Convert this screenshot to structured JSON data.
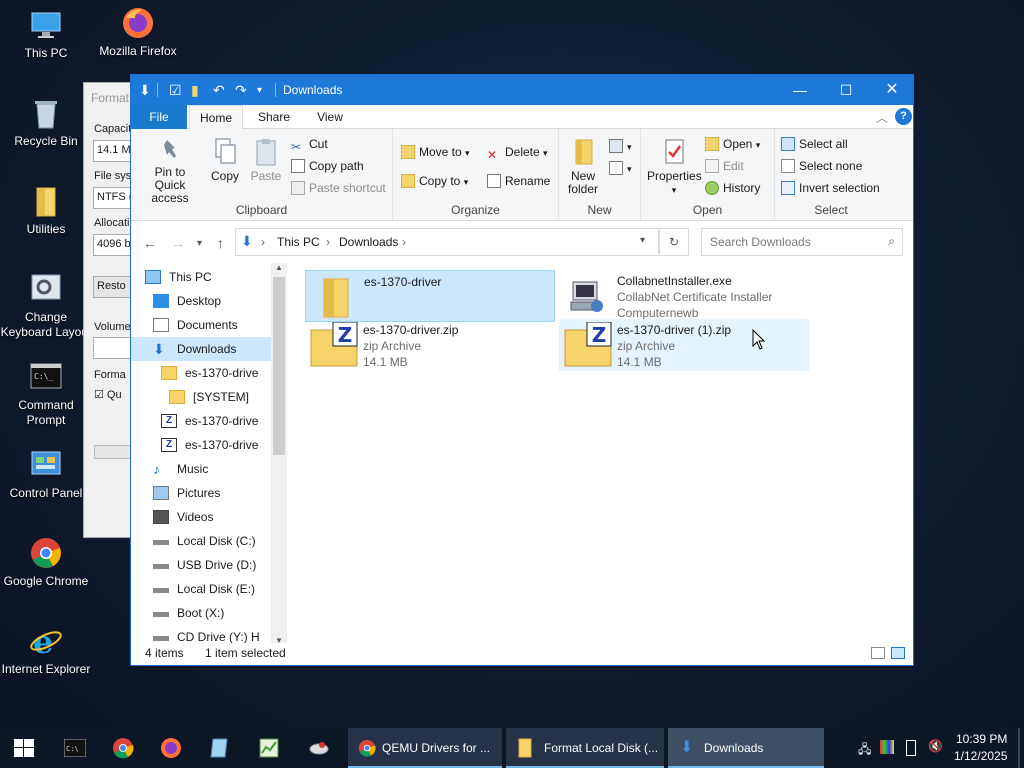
{
  "desktop": {
    "icons": [
      {
        "label": "This PC"
      },
      {
        "label": "Mozilla Firefox"
      },
      {
        "label": "Recycle Bin"
      },
      {
        "label": "Utilities"
      },
      {
        "label": "Change Keyboard Layout"
      },
      {
        "label": "Command Prompt"
      },
      {
        "label": "Control Panel"
      },
      {
        "label": "Google Chrome"
      },
      {
        "label": "Internet Explorer"
      }
    ]
  },
  "format_dialog": {
    "title": "Format",
    "capacity_label": "Capacity",
    "capacity_value": "14.1 M",
    "filesystem_label": "File sys",
    "filesystem_value": "NTFS (",
    "allocation_label": "Allocatio",
    "allocation_value": "4096 b",
    "restore_button": "Resto",
    "volume_label": "Volume",
    "format_options_label": "Forma",
    "quick_label": "Qu"
  },
  "explorer": {
    "title": "Downloads",
    "tabs": [
      "File",
      "Home",
      "Share",
      "View"
    ],
    "ribbon": {
      "clipboard": {
        "name": "Clipboard",
        "pin": "Pin to Quick access",
        "copy": "Copy",
        "paste": "Paste",
        "cut": "Cut",
        "copy_path": "Copy path",
        "paste_shortcut": "Paste shortcut"
      },
      "organize": {
        "name": "Organize",
        "move_to": "Move to",
        "copy_to": "Copy to",
        "delete": "Delete",
        "rename": "Rename"
      },
      "new": {
        "name": "New",
        "new_folder": "New folder"
      },
      "open": {
        "name": "Open",
        "properties": "Properties",
        "open": "Open",
        "edit": "Edit",
        "history": "History"
      },
      "select": {
        "name": "Select",
        "select_all": "Select all",
        "select_none": "Select none",
        "invert": "Invert selection"
      }
    },
    "address": {
      "segments": [
        "This PC",
        "Downloads"
      ],
      "search_placeholder": "Search Downloads"
    },
    "nav": [
      {
        "label": "This PC"
      },
      {
        "label": "Desktop"
      },
      {
        "label": "Documents"
      },
      {
        "label": "Downloads"
      },
      {
        "label": "es-1370-drive"
      },
      {
        "label": "[SYSTEM]"
      },
      {
        "label": "es-1370-drive"
      },
      {
        "label": "es-1370-drive"
      },
      {
        "label": "Music"
      },
      {
        "label": "Pictures"
      },
      {
        "label": "Videos"
      },
      {
        "label": "Local Disk (C:)"
      },
      {
        "label": "USB Drive (D:)"
      },
      {
        "label": "Local Disk (E:)"
      },
      {
        "label": "Boot (X:)"
      },
      {
        "label": "CD Drive (Y:) H"
      }
    ],
    "files": [
      {
        "name": "es-1370-driver",
        "type": "",
        "size": ""
      },
      {
        "name": "CollabnetInstaller.exe",
        "type": "CollabNet Certificate Installer",
        "size": "Computernewb"
      },
      {
        "name": "es-1370-driver.zip",
        "type": "zip Archive",
        "size": "14.1 MB"
      },
      {
        "name": "es-1370-driver (1).zip",
        "type": "zip Archive",
        "size": "14.1 MB"
      }
    ],
    "status": {
      "count": "4 items",
      "selected": "1 item selected"
    }
  },
  "taskbar": {
    "tasks": [
      {
        "label": "QEMU Drivers for ..."
      },
      {
        "label": "Format Local Disk (..."
      },
      {
        "label": "Downloads"
      }
    ],
    "time": "10:39 PM",
    "date": "1/12/2025"
  },
  "colors": {
    "titlebar": "#1e78d7",
    "file_tab": "#1979ca",
    "selection": "#cce8ff",
    "taskbar": "#0c1726"
  }
}
